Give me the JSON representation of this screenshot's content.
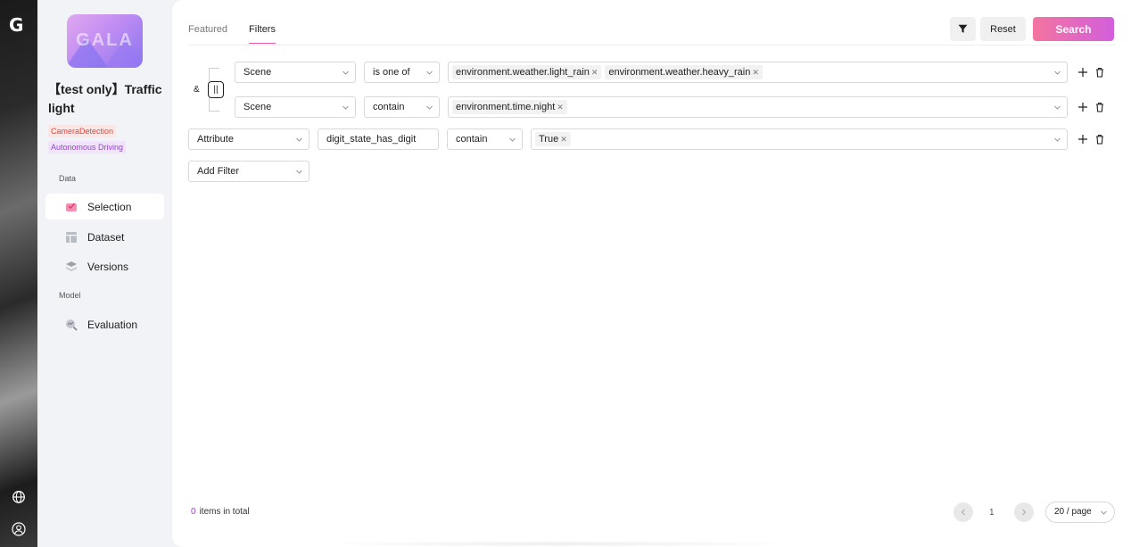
{
  "rail": {
    "logo_letter": "G",
    "icons": [
      "globe-icon",
      "user-icon"
    ]
  },
  "sidebar": {
    "project_thumb_text": "GALA",
    "project_name": "【test only】Traffic light",
    "tags": [
      "CameraDetection",
      "Autonomous Driving"
    ],
    "section_data": "Data",
    "section_model": "Model",
    "items": [
      {
        "label": "Selection",
        "icon": "selection-icon",
        "active": true
      },
      {
        "label": "Dataset",
        "icon": "dataset-icon",
        "active": false
      },
      {
        "label": "Versions",
        "icon": "versions-icon",
        "active": false
      },
      {
        "label": "Evaluation",
        "icon": "evaluation-icon",
        "active": false
      }
    ]
  },
  "header": {
    "tabs": [
      {
        "label": "Featured",
        "active": false
      },
      {
        "label": "Filters",
        "active": true
      }
    ],
    "reset_label": "Reset",
    "search_label": "Search",
    "accent_color": "#d25fdc"
  },
  "filters": {
    "group": {
      "and_label": "&",
      "or_label": "||",
      "rows": [
        {
          "field": "Scene",
          "operator": "is one of",
          "values": [
            "environment.weather.light_rain",
            "environment.weather.heavy_rain"
          ]
        },
        {
          "field": "Scene",
          "operator": "contain",
          "values": [
            "environment.time.night"
          ]
        }
      ]
    },
    "attribute_row": {
      "field": "Attribute",
      "attribute_name": "digit_state_has_digit",
      "operator": "contain",
      "values": [
        "True"
      ]
    },
    "add_filter_label": "Add Filter"
  },
  "footer": {
    "count": "0",
    "count_suffix": "items in total",
    "current_page": "1",
    "page_size": "20 / page"
  }
}
